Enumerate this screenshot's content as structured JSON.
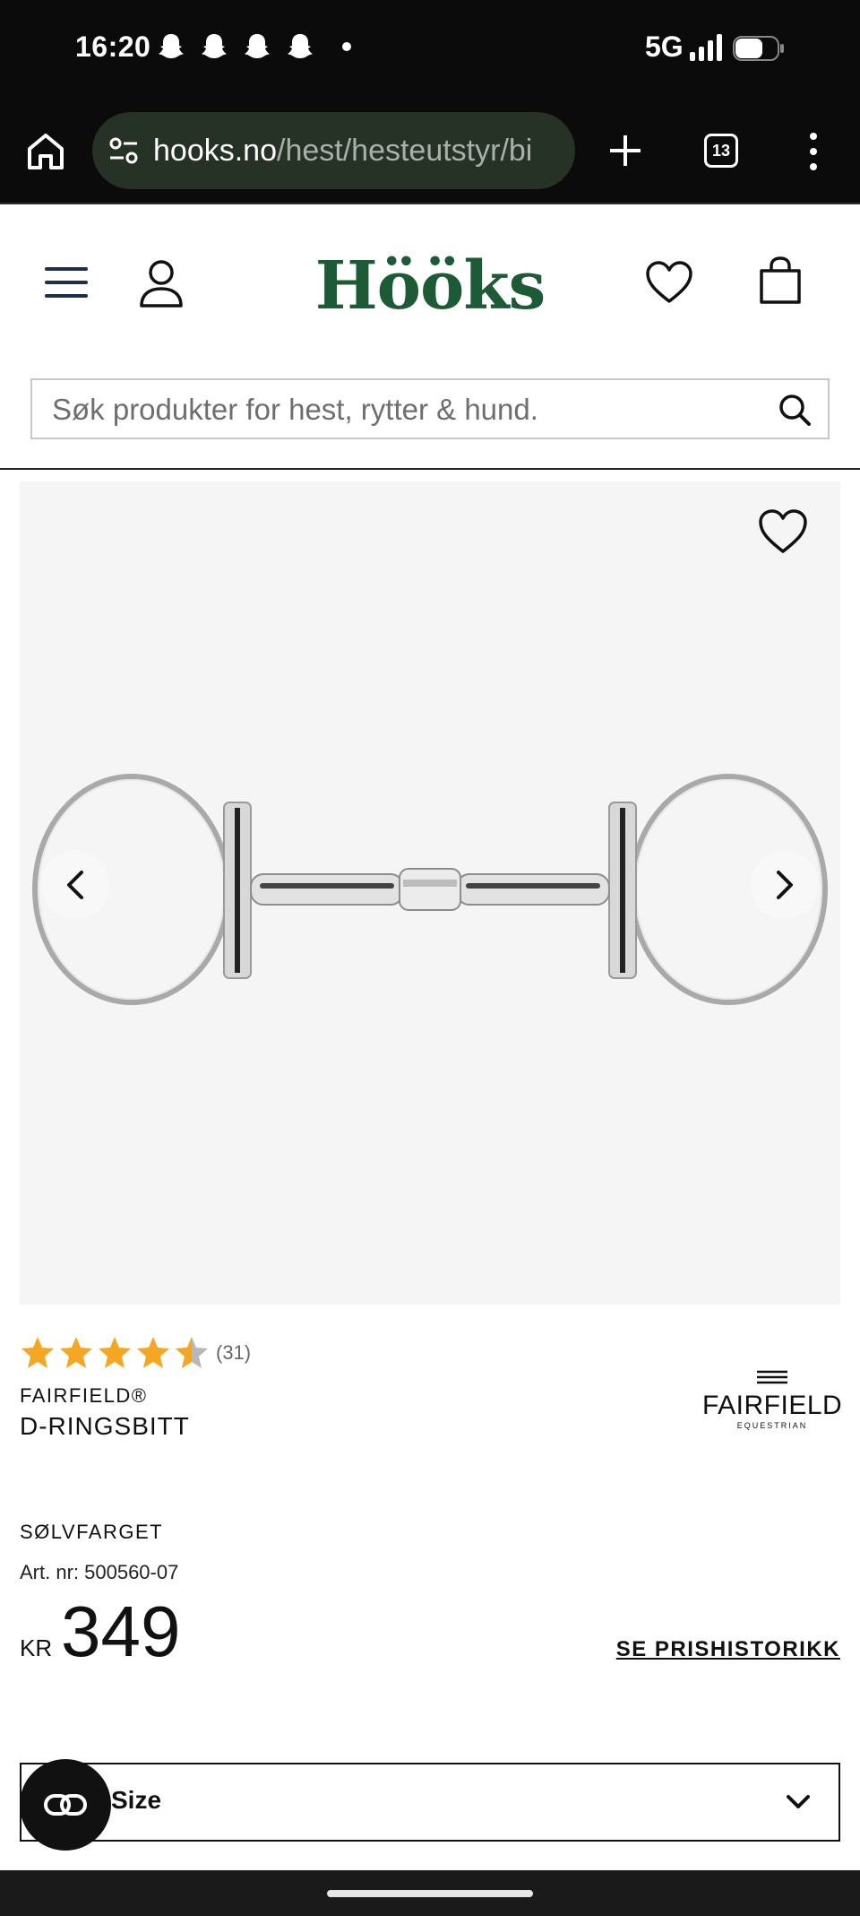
{
  "status_bar": {
    "time": "16:20",
    "network": "5G",
    "notification_icons": [
      "snapchat-icon",
      "snapchat-icon",
      "snapchat-icon",
      "snapchat-icon"
    ]
  },
  "browser": {
    "url_host": "hooks.no",
    "url_path": "/hest/hesteutstyr/bi",
    "tab_count": "13"
  },
  "header": {
    "logo": "Hööks",
    "search_placeholder": "Søk produkter for hest, rytter & hund."
  },
  "product": {
    "rating_stars": 4.5,
    "rating_count": "(31)",
    "brand": "FAIRFIELD®",
    "name": "D-RINGSBITT",
    "brand_logo_name": "FAIRFIELD",
    "brand_logo_sub": "EQUESTRIAN",
    "color": "SØLVFARGET",
    "article_number": "Art. nr: 500560-07",
    "currency": "KR",
    "price": "349",
    "price_history_link": "SE PRISHISTORIKK",
    "size_label": "Size"
  },
  "colors": {
    "brand_green": "#1d5a36",
    "star_gold": "#f5a623",
    "star_gray": "#b8b8b8"
  }
}
